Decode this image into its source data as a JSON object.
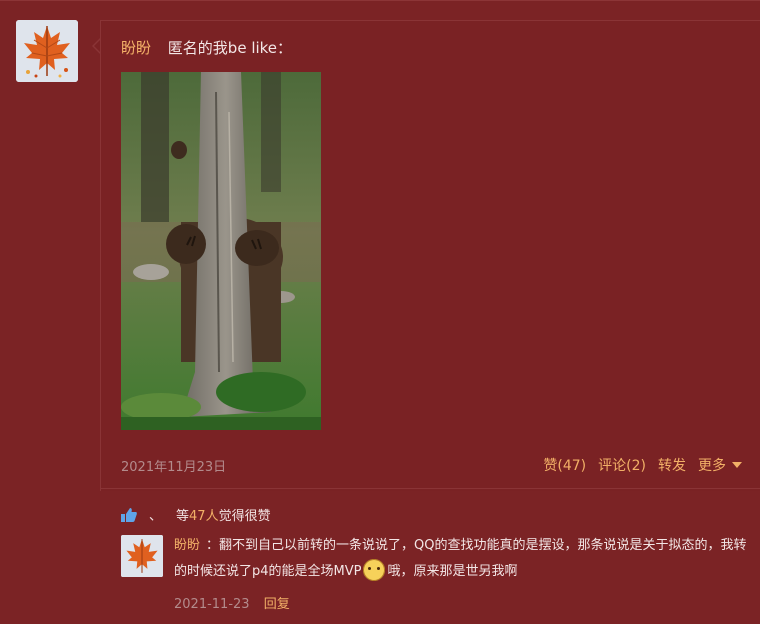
{
  "post": {
    "author": "盼盼",
    "text": "匿名的我be like：",
    "date": "2021年11月23日",
    "image_alt": "bear hiding behind a tree trunk",
    "actions": {
      "like": "赞(47)",
      "comment": "评论(2)",
      "share": "转发",
      "more": "更多"
    }
  },
  "likes": {
    "separator": "、",
    "prefix": "等",
    "count": "47人",
    "suffix": "觉得很赞"
  },
  "comment": {
    "author": "盼盼",
    "text_part1": "：翻不到自己以前转的一条说说了，QQ的查找功能真的是摆设，那条说说是关于拟态的，我转的时候还说了p4的能是全场MVP",
    "text_part2": "哦，原来那是世另我啊",
    "date": "2021-11-23",
    "reply": "回复"
  },
  "colors": {
    "background": "#7b2325",
    "accent": "#f2b067",
    "muted": "#b38b8c"
  }
}
